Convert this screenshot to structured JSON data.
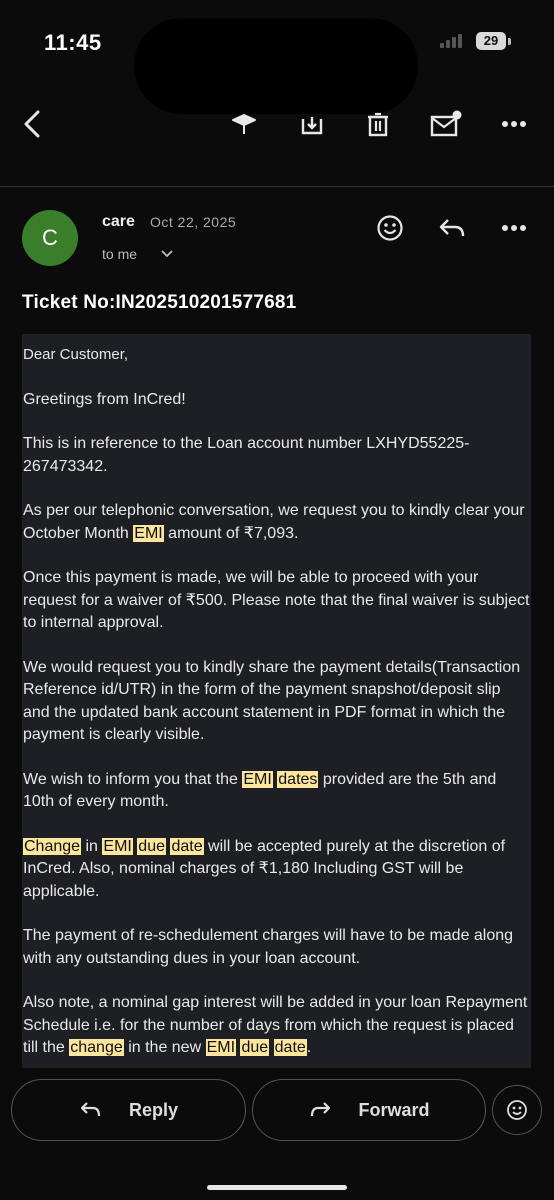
{
  "status_bar": {
    "time": "11:45",
    "battery": "29"
  },
  "toolbar": {
    "icons": [
      "back-arrow-icon",
      "label-icon",
      "archive-icon",
      "trash-icon",
      "mark-unread-icon",
      "more-icon"
    ]
  },
  "email": {
    "sender_initial": "C",
    "sender_name": "care",
    "date": "Oct 22, 2025",
    "recipient": "to me",
    "subject": "Ticket No:IN202510201577681",
    "body": {
      "greeting": "Dear Customer,",
      "p1": "Greetings from InCred!",
      "p2": "This is in reference to the Loan account number LXHYD55225-267473342.",
      "p3_a": "As per our telephonic conversation, we request you to kindly clear your October Month ",
      "p3_hl": "EMI",
      "p3_b": " amount of ₹7,093.",
      "p4": "Once this payment is made, we will be able to proceed with your request for a waiver of ₹500. Please note that the final waiver is subject to internal approval.",
      "p5": "We would request you to kindly share the payment details(Transaction Reference id/UTR) in the form of the payment snapshot/deposit slip and the updated bank account statement in PDF format in which the payment is clearly visible.",
      "p6_a": "We wish to inform you that the ",
      "p6_hl1": "EMI",
      "p6_hl2": "dates",
      "p6_b": " provided are the 5th and 10th of every month.",
      "p7_hl1": "Change",
      "p7_a": " in ",
      "p7_hl2": "EMI",
      "p7_hl3": "due",
      "p7_hl4": "date",
      "p7_b": " will be accepted purely at the discretion of InCred. Also, nominal charges of ₹1,180 Including GST will be applicable.",
      "p8": "The payment of re-schedulement charges will have to be made along with any outstanding dues in your loan account.",
      "p9_a": "Also note, a nominal gap interest will be added in your loan Repayment Schedule i.e. for the number of days from which the request is placed till the ",
      "p9_hl1": "change",
      "p9_b": " in the new ",
      "p9_hl2": "EMI",
      "p9_hl3": "due",
      "p9_hl4": "date",
      "p9_c": "."
    }
  },
  "actions": {
    "reply": "Reply",
    "forward": "Forward"
  },
  "colors": {
    "avatar": "#3a7d2a",
    "highlight": "#fce59c",
    "body_bg": "#1e1f24"
  }
}
